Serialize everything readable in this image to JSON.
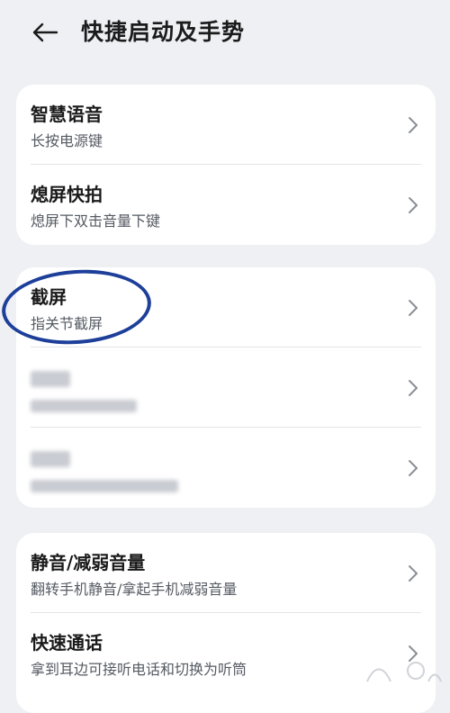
{
  "header": {
    "title": "快捷启动及手势"
  },
  "card1": {
    "items": [
      {
        "label": "智慧语音",
        "sub": "长按电源键"
      },
      {
        "label": "熄屏快拍",
        "sub": "熄屏下双击音量下键"
      }
    ]
  },
  "card2": {
    "items": [
      {
        "label": "截屏",
        "sub": "指关节截屏"
      }
    ]
  },
  "card3": {
    "items": [
      {
        "label": "静音/减弱音量",
        "sub": "翻转手机静音/拿起手机减弱音量"
      },
      {
        "label": "快速通话",
        "sub": "拿到耳边可接听电话和切换为听筒"
      }
    ]
  },
  "colors": {
    "background": "#eef0f4",
    "card": "#ffffff",
    "annotation": "#1d3f9a"
  }
}
